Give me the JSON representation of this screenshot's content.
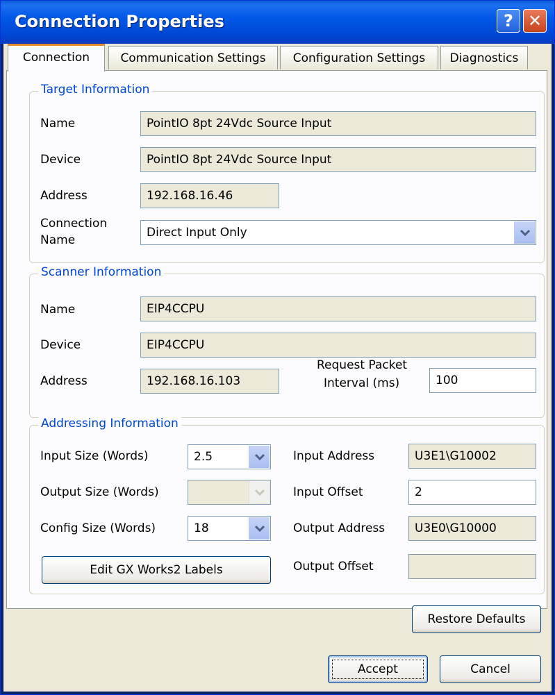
{
  "window": {
    "title": "Connection Properties",
    "help_glyph": "?",
    "close_glyph": "✕"
  },
  "tabs": [
    {
      "label": "Connection",
      "active": true
    },
    {
      "label": "Communication Settings",
      "active": false
    },
    {
      "label": "Configuration Settings",
      "active": false
    },
    {
      "label": "Diagnostics",
      "active": false
    }
  ],
  "target": {
    "group_label": "Target Information",
    "name_label": "Name",
    "name_value": "PointIO 8pt 24Vdc Source Input",
    "device_label": "Device",
    "device_value": "PointIO 8pt 24Vdc Source Input",
    "address_label": "Address",
    "address_value": "192.168.16.46",
    "connection_label_1": "Connection",
    "connection_label_2": "Name",
    "connection_value": "Direct Input Only"
  },
  "scanner": {
    "group_label": "Scanner Information",
    "name_label": "Name",
    "name_value": "EIP4CCPU",
    "device_label": "Device",
    "device_value": "EIP4CCPU",
    "address_label": "Address",
    "address_value": "192.168.16.103",
    "rpi_label_1": "Request Packet",
    "rpi_label_2": "Interval (ms)",
    "rpi_value": "100"
  },
  "addressing": {
    "group_label": "Addressing Information",
    "input_size_label": "Input Size (Words)",
    "input_size_value": "2.5",
    "output_size_label": "Output Size (Words)",
    "output_size_value": "",
    "config_size_label": "Config Size (Words)",
    "config_size_value": "18",
    "input_address_label": "Input Address",
    "input_address_value": "U3E1\\G10002",
    "input_offset_label": "Input Offset",
    "input_offset_value": "2",
    "output_address_label": "Output Address",
    "output_address_value": "U3E0\\G10000",
    "output_offset_label": "Output Offset",
    "output_offset_value": "",
    "edit_labels_button": "Edit GX Works2 Labels"
  },
  "buttons": {
    "restore_defaults": "Restore Defaults",
    "accept": "Accept",
    "cancel": "Cancel"
  },
  "colors": {
    "titlebar": "#0058e6",
    "group_label": "#0046d5",
    "tab_active_accent": "#e68b2c",
    "readonly_field": "#ece9d8"
  },
  "icons": {
    "help": "help-icon",
    "close": "close-icon",
    "dropdown": "chevron-down-icon"
  }
}
